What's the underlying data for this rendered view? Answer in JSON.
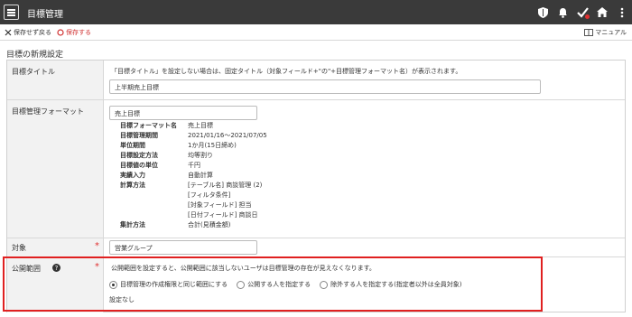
{
  "header": {
    "title": "目標管理",
    "icons": [
      "menu-icon",
      "shield-icon",
      "bell-icon",
      "check-icon",
      "home-icon",
      "more-icon"
    ]
  },
  "toolbar": {
    "discard_label": "保存せず戻る",
    "save_label": "保存する",
    "manual_label": "マニュアル"
  },
  "page": {
    "section_title": "目標の新規設定"
  },
  "form": {
    "goal_title": {
      "label": "目標タイトル",
      "hint": "「目標タイトル」を設定しない場合は、固定タイトル（対象フィールド+\"の\"+目標管理フォーマット名）が表示されます。",
      "value": "上半期売上目標"
    },
    "format": {
      "label": "目標管理フォーマット",
      "value": "売上目標",
      "details": [
        {
          "key": "目標フォーマット名",
          "value": "売上目標"
        },
        {
          "key": "目標管理期間",
          "value": "2021/01/16～2021/07/05"
        },
        {
          "key": "単位期間",
          "value": "1か月(15日締め)"
        },
        {
          "key": "目標設定方法",
          "value": "均等割り"
        },
        {
          "key": "目標値の単位",
          "value": "千円"
        },
        {
          "key": "実績入力",
          "value": "自動計算"
        },
        {
          "key": "計算方法",
          "value": "[テーブル名] 商談管理 (2)"
        },
        {
          "key": "",
          "value": "[フィルタ条件]"
        },
        {
          "key": "",
          "value": "[対象フィールド] 担当"
        },
        {
          "key": "",
          "value": "[日付フィールド] 商談日"
        },
        {
          "key": "集計方法",
          "value": "合計(見積金額)"
        }
      ]
    },
    "target": {
      "label": "対象",
      "required_mark": "*",
      "value": "営業グループ"
    },
    "scope": {
      "label": "公開範囲",
      "required_mark": "*",
      "description": "公開範囲を設定すると、公開範囲に該当しないユーザは目標管理の存在が見えなくなります。",
      "options": [
        {
          "label": "目標管理の作成権限と同じ範囲にする",
          "selected": true
        },
        {
          "label": "公開する人を指定する",
          "selected": false
        },
        {
          "label": "除外する人を指定する(指定者以外は全員対象)",
          "selected": false
        }
      ],
      "status": "設定なし"
    }
  },
  "colors": {
    "header_bg": "#3a3a3a",
    "save_accent": "#d03030",
    "highlight": "#e02020",
    "required": "#e03030"
  }
}
